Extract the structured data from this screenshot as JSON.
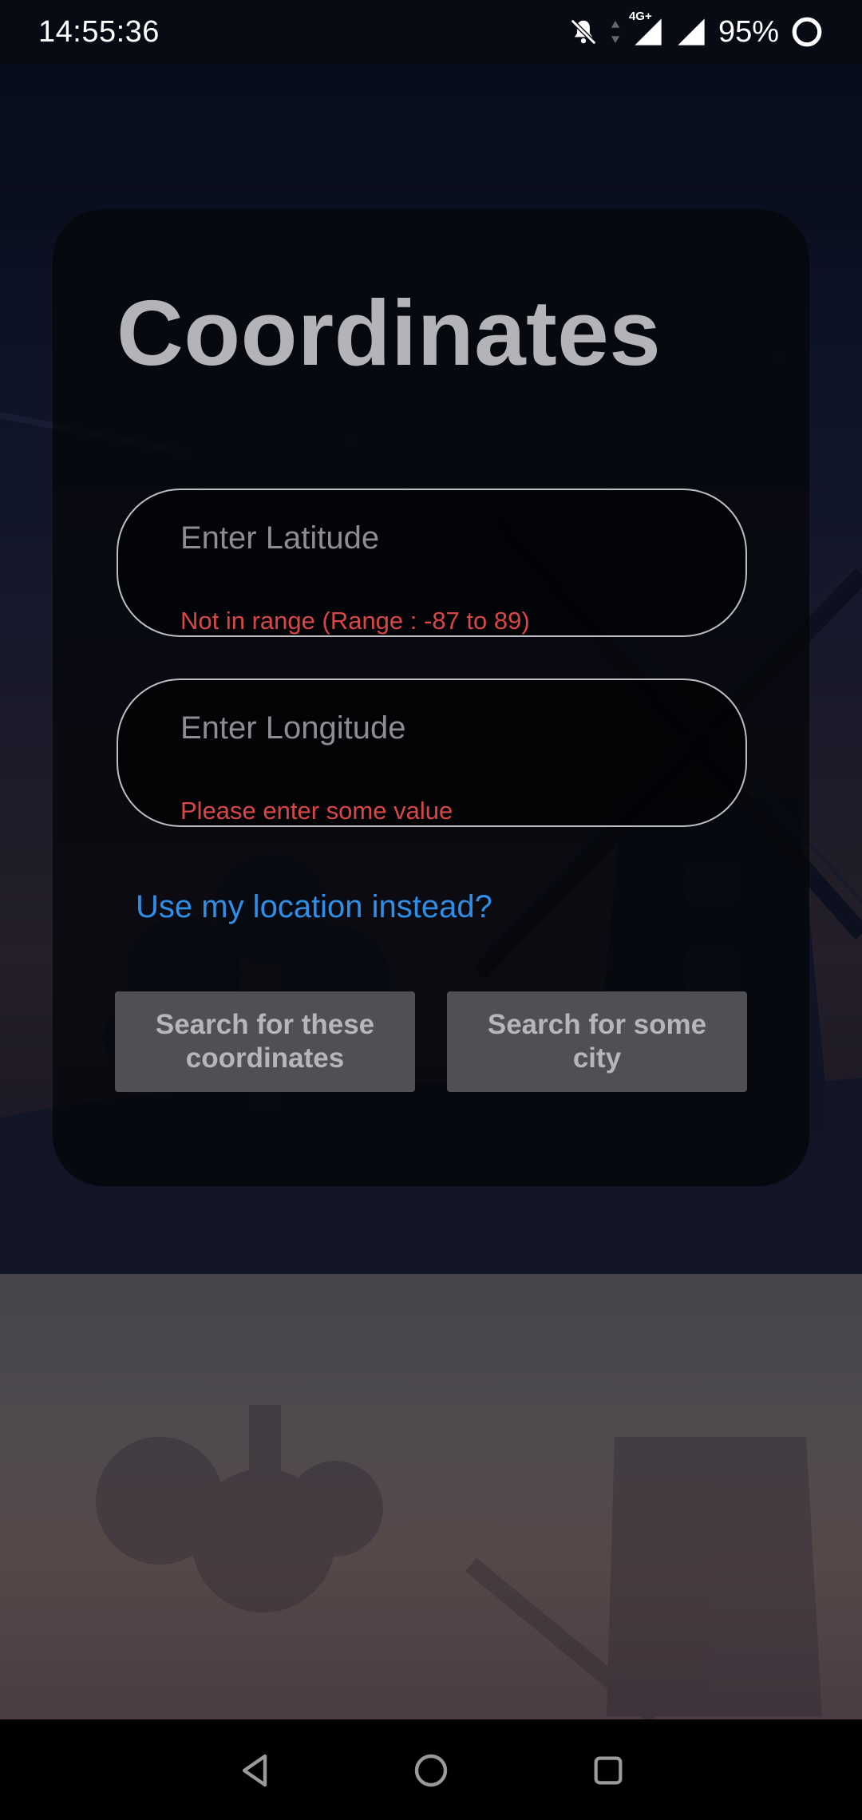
{
  "status_bar": {
    "time": "14:55:36",
    "battery_percent": "95%",
    "network_label": "4G+",
    "icons": [
      "bell-off-icon",
      "data-arrows-icon",
      "signal-icon",
      "signal-icon",
      "battery-ring-icon"
    ]
  },
  "card": {
    "title": "Coordinates",
    "latitude": {
      "value": "",
      "placeholder": "Enter Latitude",
      "error": "Not in range (Range : -87 to 89)"
    },
    "longitude": {
      "value": "",
      "placeholder": "Enter Longitude",
      "error": "Please enter some value"
    },
    "location_link": "Use my location instead?",
    "buttons": {
      "search_coordinates": "Search for these coordinates",
      "search_city": "Search for some city"
    }
  },
  "nav_bar": {
    "icons": [
      "back-icon",
      "home-icon",
      "recents-icon"
    ]
  },
  "colors": {
    "error": "#d84747",
    "link": "#2f8ee6",
    "title": "#b3b3b8",
    "button_bg": "#4f4f54"
  }
}
